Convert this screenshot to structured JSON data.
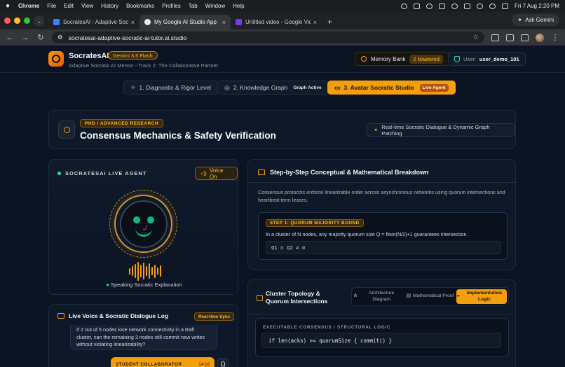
{
  "menubar": {
    "app": "Chrome",
    "items": [
      "File",
      "Edit",
      "View",
      "History",
      "Bookmarks",
      "Profiles",
      "Tab",
      "Window",
      "Help"
    ],
    "clock": "Fri 7 Aug  2:20 PM"
  },
  "browser": {
    "tabs": [
      {
        "title": "SocratesAI - Adaptive Socrati",
        "favicon_color": "#3b82f6"
      },
      {
        "title": "My Google AI Studio App",
        "favicon_color": "#e8eaed"
      },
      {
        "title": "Untitled video - Google Vids",
        "favicon_color": "#7c3aed"
      }
    ],
    "new_tab": "+",
    "ask_gemini": "Ask Gemini",
    "url": "socratesai-adaptive-socratic-ai-tutor.ai.studio"
  },
  "app": {
    "brand": "SocratesAI",
    "model": "Gemini 3.5 Flash",
    "tagline": "Adaptive Socratic AI Mentor - Track 2: The Collaborative Partner",
    "memory_label": "Memory Bank",
    "memory_count": "2 Mastered",
    "user_prefix": "User:",
    "user_name": "user_demo_101",
    "steps": [
      {
        "label": "1. Diagnostic & Rigor Level",
        "badge": ""
      },
      {
        "label": "2. Knowledge Graph",
        "badge": "Graph Active"
      },
      {
        "label": "3. Avatar Socratic Studio",
        "badge": "Live Agent"
      }
    ],
    "topic": {
      "level": "PHD / ADVANCED RESEARCH",
      "title": "Consensus Mechanics & Safety Verification",
      "realtime": "Real-time Socratic Dialogue & Dynamic Graph Patching"
    },
    "agent": {
      "label": "SOCRATESAI LIVE AGENT",
      "voice": "Voice On",
      "status": "Speaking Socratic Explanation"
    },
    "breakdown": {
      "title": "Step-by-Step Conceptual & Mathematical Breakdown",
      "body": "Consensus protocols enforce linearizable order across asynchronous networks using quorum intersections and heartbeat term leases.",
      "step_tag": "STEP 1: QUORUM MAJORITY BOUND",
      "step_text": "In a cluster of N nodes, any majority quorum size Q = floor(N/2)+1 guarantees intersection.",
      "equation": "Q1 ∩ Q2 ≠ ∅"
    },
    "log": {
      "title": "Live Voice & Socratic Dialogue Log",
      "badge": "Real-time Sync",
      "message": "If 2 out of 5 nodes lose network connectivity in a Raft cluster, can the remaining 3 nodes still commit new writes without violating linearizability?",
      "student_label": "STUDENT COLLABORATOR",
      "student_time": "14:18"
    },
    "topology": {
      "title": "Cluster Topology & Quorum Intersections",
      "options": [
        "Architecture Diagram",
        "Mathematical Proof",
        "Implementation Logic"
      ],
      "active_option": 2,
      "code_label": "EXECUTABLE CONSENSUS / STRUCTURAL LOGIC",
      "code": "if len(acks) >= quorumSize { commit() }"
    }
  },
  "colors": {
    "accent": "#f59e0b",
    "success": "#34d399",
    "bg": "#0c1322"
  }
}
